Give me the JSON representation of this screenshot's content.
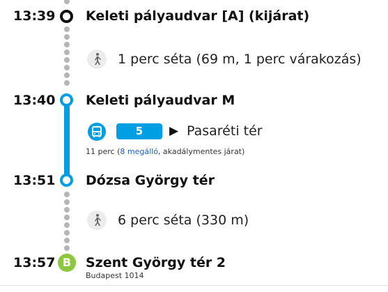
{
  "stops": [
    {
      "time": "13:39",
      "name": "Keleti pályaudvar [A] (kijárat)"
    },
    {
      "time": "13:40",
      "name": "Keleti pályaudvar M"
    },
    {
      "time": "13:51",
      "name": "Dózsa György tér"
    },
    {
      "time": "13:57",
      "name": "Szent György tér 2",
      "sub": "Budapest 1014",
      "badge": "B"
    }
  ],
  "walks": [
    {
      "text": "1 perc séta (69 m, 1 perc várakozás)",
      "icon": "walk-icon"
    },
    {
      "text": "6 perc séta (330 m)",
      "icon": "walk-icon"
    }
  ],
  "transit": {
    "route": "5",
    "direction": "Pasaréti tér",
    "arrow": "▶",
    "meta_prefix": "11 perc (",
    "meta_link": "8 megálló",
    "meta_suffix": ", akadálymentes járat)",
    "icon": "bus-icon",
    "color": "#009fe3"
  },
  "colors": {
    "line_blue": "#009fe3",
    "walk_dots": "#b5b5b5",
    "destination": "#8dc63f"
  }
}
